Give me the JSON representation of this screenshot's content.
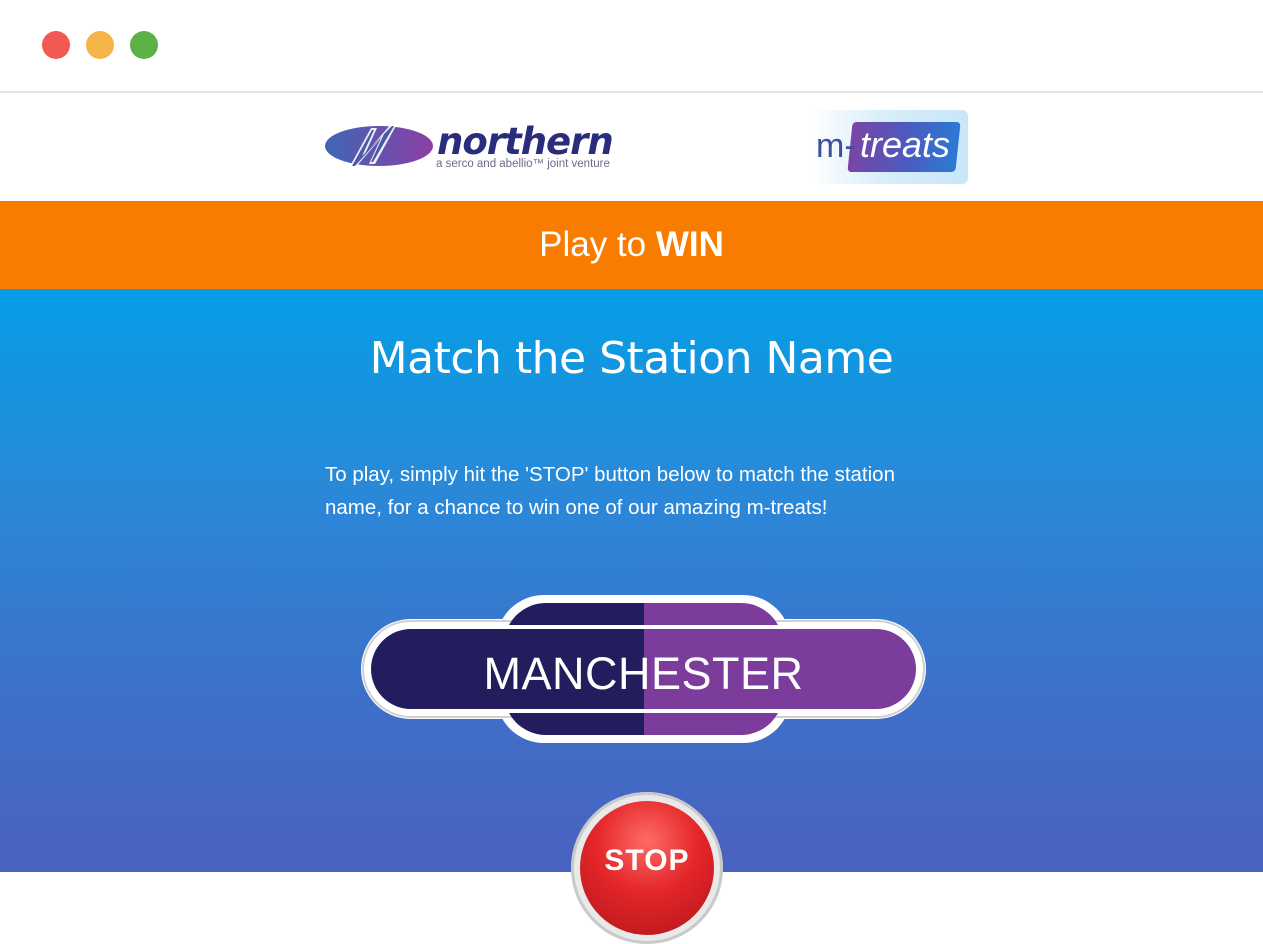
{
  "window": {
    "controls": [
      "close",
      "minimize",
      "maximize"
    ],
    "colors": {
      "close": "#f05a52",
      "minimize": "#f6b548",
      "maximize": "#5cb147"
    }
  },
  "header": {
    "northern_logo": {
      "name": "northern",
      "tagline": "a serco and abellio™ joint venture"
    },
    "mtreats_logo": {
      "m_part": "m-",
      "treats_part": "treats"
    }
  },
  "banner": {
    "prefix": "Play to ",
    "emphasis": "WIN",
    "color": "#f87c00"
  },
  "game": {
    "title": "Match the Station Name",
    "instructions": "To play, simply hit the 'STOP' button below to match the station name, for a chance to win one of our amazing m-treats!",
    "station_name": "MANCHESTER",
    "stop_label": "STOP",
    "colors": {
      "sign_left": "#231c5d",
      "sign_right": "#7c3c9b",
      "stop": "#e3262a"
    }
  }
}
